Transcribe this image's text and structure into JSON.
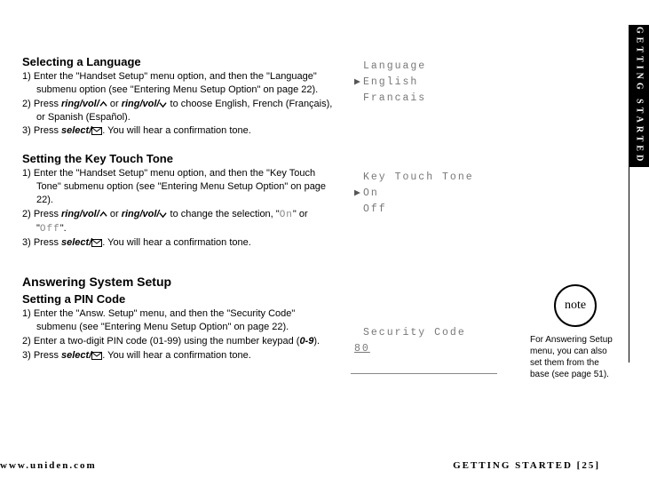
{
  "tab_label": "GETTING STARTED",
  "sec1": {
    "heading": "Selecting a Language",
    "li1_a": "1) Enter the \"Handset Setup\" menu option, and then the \"Language\" submenu option (see \"Entering Menu Setup Option\" on page 22).",
    "li2_a": "2) Press ",
    "li2_b": "ring/vol/",
    "li2_c": " or ",
    "li2_d": "ring/vol/",
    "li2_e": " to choose English, French (Français), or Spanish (Español).",
    "li3_a": "3) Press ",
    "li3_b": "select/",
    "li3_c": ". You will hear a confirmation tone."
  },
  "lcd1": {
    "r1": "Language",
    "r2": "English",
    "r3": "Francais"
  },
  "sec2": {
    "heading": "Setting the Key Touch Tone",
    "li1_a": "1) Enter the \"Handset Setup\" menu option, and then the \"Key Touch Tone\" submenu option (see \"Entering Menu Setup Option\" on page 22).",
    "li2_a": "2) Press ",
    "li2_b": "ring/vol/",
    "li2_c": " or ",
    "li2_d": "ring/vol/",
    "li2_e": " to change the selection, \"",
    "li2_on": "On",
    "li2_f": "\" or \"",
    "li2_off": "Off",
    "li2_g": "\".",
    "li3_a": "3) Press ",
    "li3_b": "select/",
    "li3_c": ". You will hear a confirmation tone."
  },
  "lcd2": {
    "r1": "Key Touch Tone",
    "r2": "On",
    "r3": "Off"
  },
  "sec3h1": "Answering System Setup",
  "sec3": {
    "heading": "Setting a PIN Code",
    "li1_a": "1) Enter the \"Answ. Setup\" menu, and then the \"Security Code\" submenu (see \"Entering Menu Setup Option\" on page 22).",
    "li2_a": "2) Enter a two-digit PIN code (01-99) using the number keypad (",
    "li2_b": "0-9",
    "li2_c": ").",
    "li3_a": "3) Press ",
    "li3_b": "select/",
    "li3_c": ". You will hear a confirmation tone."
  },
  "lcd3": {
    "r1": "Security Code",
    "r2": "80"
  },
  "note": {
    "label": "note",
    "text": "For Answering Setup menu, you can also set them from the base (see page 51)."
  },
  "footer": {
    "url": "www.uniden.com",
    "page": "GETTING STARTED [25]"
  }
}
